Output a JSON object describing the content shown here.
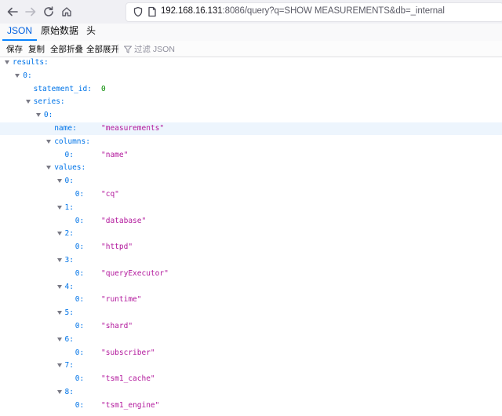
{
  "browser": {
    "url_host": "192.168.16.131",
    "url_rest": ":8086/query?q=SHOW MEASUREMENTS&db=_internal"
  },
  "tabs": [
    {
      "label": "JSON",
      "active": true
    },
    {
      "label": "原始数据",
      "active": false
    },
    {
      "label": "头",
      "active": false
    }
  ],
  "toolbar": {
    "save": "保存",
    "copy": "复制",
    "collapse_all": "全部折叠",
    "expand_all": "全部展开",
    "filter_placeholder": "过滤 JSON"
  },
  "colors": {
    "key": "#0074e8",
    "string": "#b2179c",
    "number": "#058b00",
    "tab_active": "#0060df",
    "row_highlight": "#edf5fd"
  },
  "tree": [
    {
      "key": "results:",
      "depth": 0,
      "expandable": true
    },
    {
      "key": "0:",
      "depth": 1,
      "expandable": true
    },
    {
      "key": "statement_id:",
      "depth": 2,
      "value": "0",
      "type": "number"
    },
    {
      "key": "series:",
      "depth": 2,
      "expandable": true
    },
    {
      "key": "0:",
      "depth": 3,
      "expandable": true
    },
    {
      "key": "name:",
      "depth": 4,
      "value": "\"measurements\"",
      "type": "string",
      "highlight": true
    },
    {
      "key": "columns:",
      "depth": 4,
      "expandable": true
    },
    {
      "key": "0:",
      "depth": 5,
      "value": "\"name\"",
      "type": "string"
    },
    {
      "key": "values:",
      "depth": 4,
      "expandable": true
    },
    {
      "key": "0:",
      "depth": 5,
      "expandable": true
    },
    {
      "key": "0:",
      "depth": 6,
      "value": "\"cq\"",
      "type": "string"
    },
    {
      "key": "1:",
      "depth": 5,
      "expandable": true
    },
    {
      "key": "0:",
      "depth": 6,
      "value": "\"database\"",
      "type": "string"
    },
    {
      "key": "2:",
      "depth": 5,
      "expandable": true
    },
    {
      "key": "0:",
      "depth": 6,
      "value": "\"httpd\"",
      "type": "string"
    },
    {
      "key": "3:",
      "depth": 5,
      "expandable": true
    },
    {
      "key": "0:",
      "depth": 6,
      "value": "\"queryExecutor\"",
      "type": "string"
    },
    {
      "key": "4:",
      "depth": 5,
      "expandable": true
    },
    {
      "key": "0:",
      "depth": 6,
      "value": "\"runtime\"",
      "type": "string"
    },
    {
      "key": "5:",
      "depth": 5,
      "expandable": true
    },
    {
      "key": "0:",
      "depth": 6,
      "value": "\"shard\"",
      "type": "string"
    },
    {
      "key": "6:",
      "depth": 5,
      "expandable": true
    },
    {
      "key": "0:",
      "depth": 6,
      "value": "\"subscriber\"",
      "type": "string"
    },
    {
      "key": "7:",
      "depth": 5,
      "expandable": true
    },
    {
      "key": "0:",
      "depth": 6,
      "value": "\"tsm1_cache\"",
      "type": "string"
    },
    {
      "key": "8:",
      "depth": 5,
      "expandable": true
    },
    {
      "key": "0:",
      "depth": 6,
      "value": "\"tsm1_engine\"",
      "type": "string"
    }
  ]
}
